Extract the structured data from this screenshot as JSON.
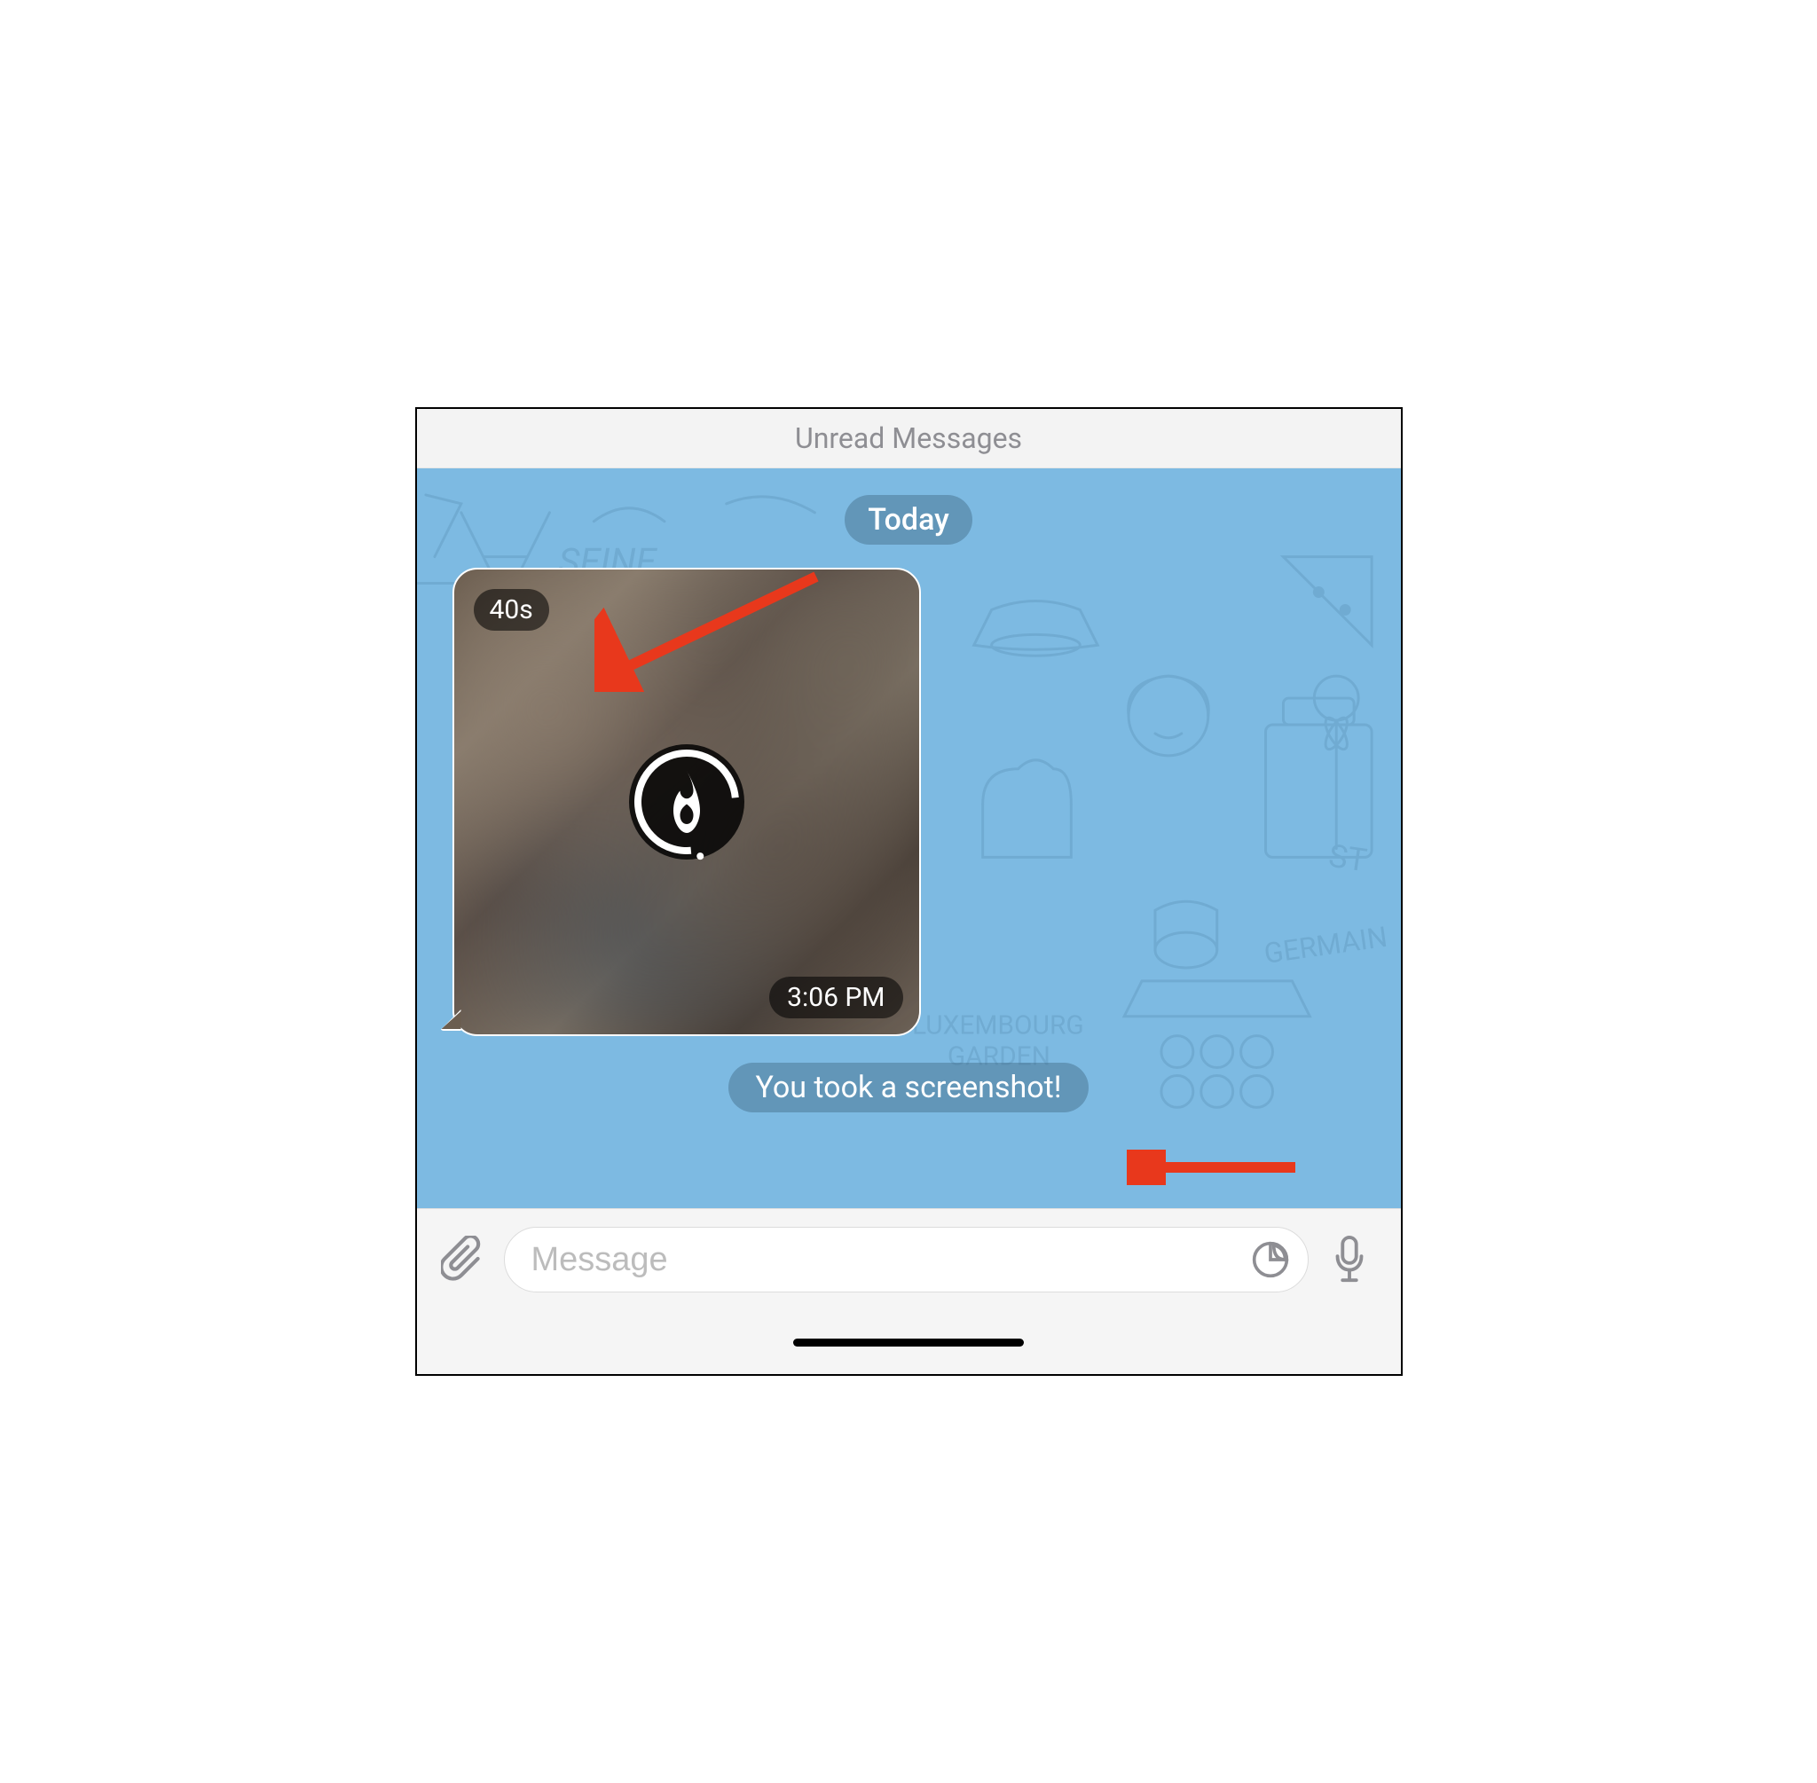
{
  "banner": {
    "unread_label": "Unread Messages"
  },
  "chat": {
    "date_label": "Today",
    "media": {
      "timer_text": "40s",
      "timestamp": "3:06 PM",
      "icon_name": "flame-icon"
    },
    "system_message": "You took a screenshot!"
  },
  "input": {
    "placeholder": "Message",
    "value": ""
  },
  "icons": {
    "attach": "attach-icon",
    "sticker": "sticker-icon",
    "mic": "mic-icon"
  },
  "annotations": {
    "arrow_color": "#e8381c"
  }
}
